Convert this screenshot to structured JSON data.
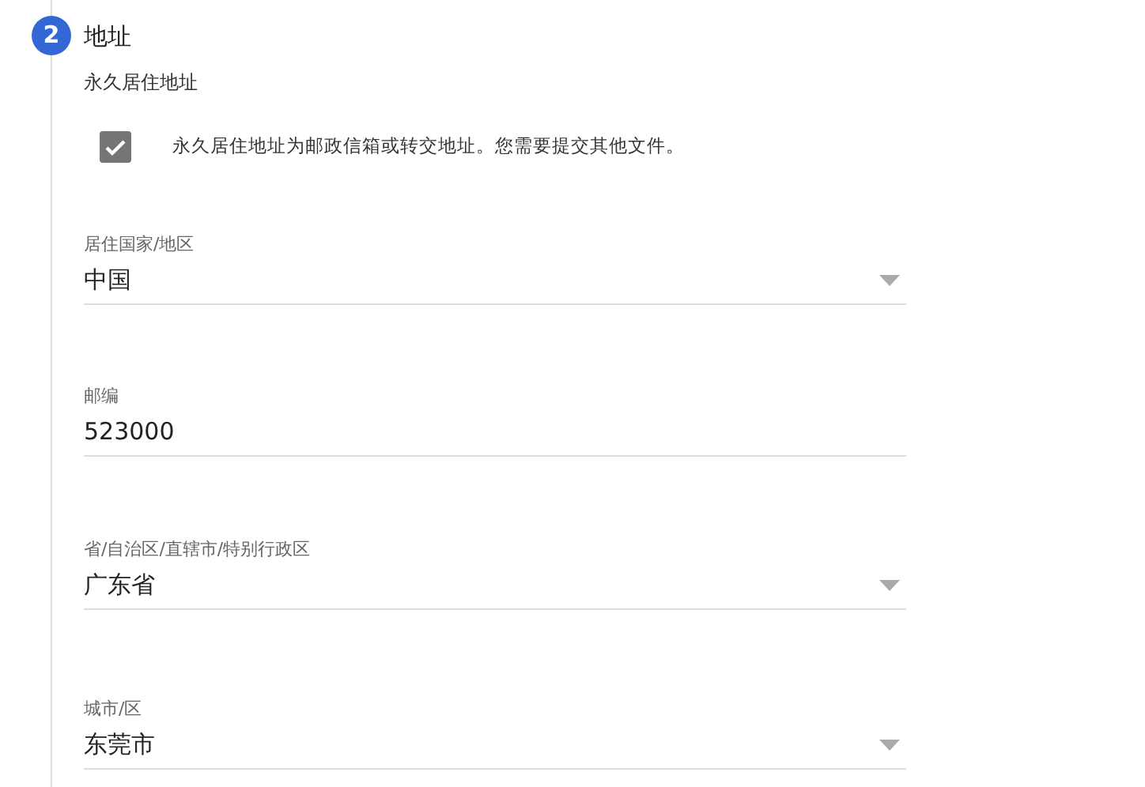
{
  "step": {
    "number": "2",
    "title": "地址",
    "active": true
  },
  "subtitle": "永久居住地址",
  "checkbox": {
    "label": "永久居住地址为邮政信箱或转交地址。您需要提交其他文件。",
    "checked": true
  },
  "fields": [
    {
      "kind": "select",
      "label": "居住国家/地区",
      "value": "中国"
    },
    {
      "kind": "text",
      "label": "邮编",
      "value": "523000"
    },
    {
      "kind": "select",
      "label": "省/自治区/直辖市/特别行政区",
      "value": "广东省"
    },
    {
      "kind": "select",
      "label": "城市/区",
      "value": "东莞市"
    }
  ]
}
